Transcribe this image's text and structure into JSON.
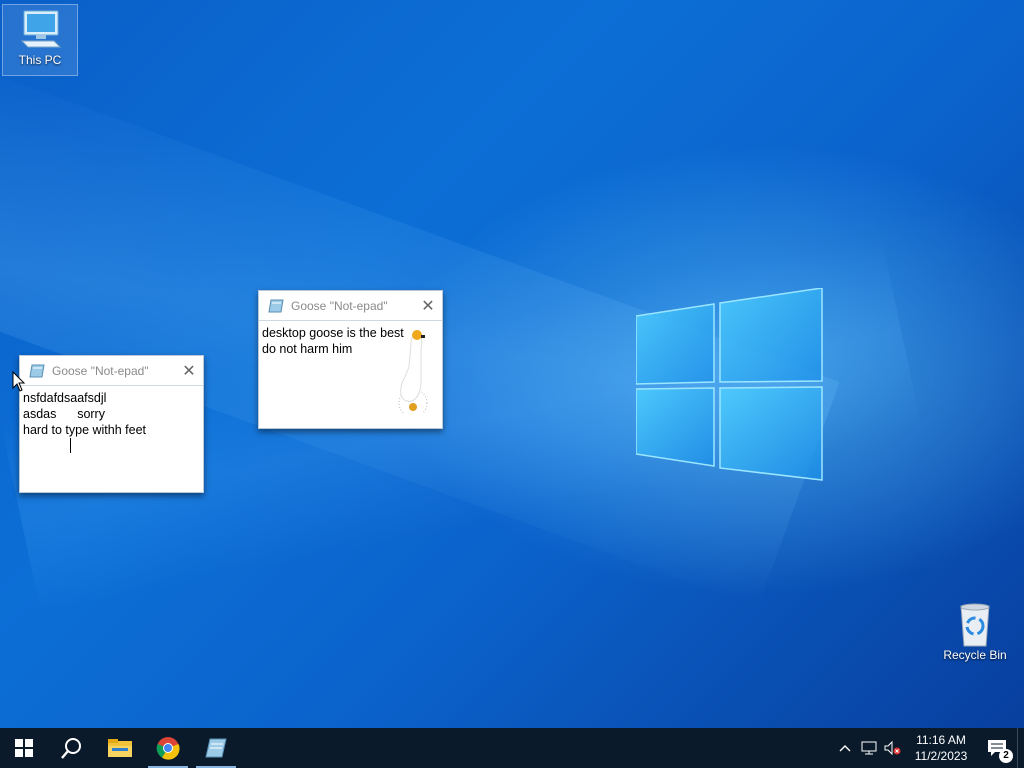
{
  "desktop": {
    "icons": [
      {
        "label": "This PC",
        "icon": "computer-icon"
      },
      {
        "label": "Recycle Bin",
        "icon": "recycle-bin-icon"
      }
    ]
  },
  "windows": [
    {
      "title": "Goose \"Not-epad\"",
      "lines": [
        "nsfdafdsaafsdjl",
        "asdas      sorry",
        "hard to type withh feet"
      ]
    },
    {
      "title": "Goose \"Not-epad\"",
      "lines": [
        "desktop goose is the best",
        "do not harm him"
      ]
    }
  ],
  "taskbar": {
    "items": [
      "start-icon",
      "search-icon",
      "file-explorer-icon",
      "chrome-icon",
      "notepad-icon"
    ],
    "tray": {
      "time": "11:16 AM",
      "date": "11/2/2023",
      "notification_count": "2"
    }
  },
  "colors": {
    "taskbar": "#0a1a2a",
    "wallpaper": "#0c6fd6"
  }
}
